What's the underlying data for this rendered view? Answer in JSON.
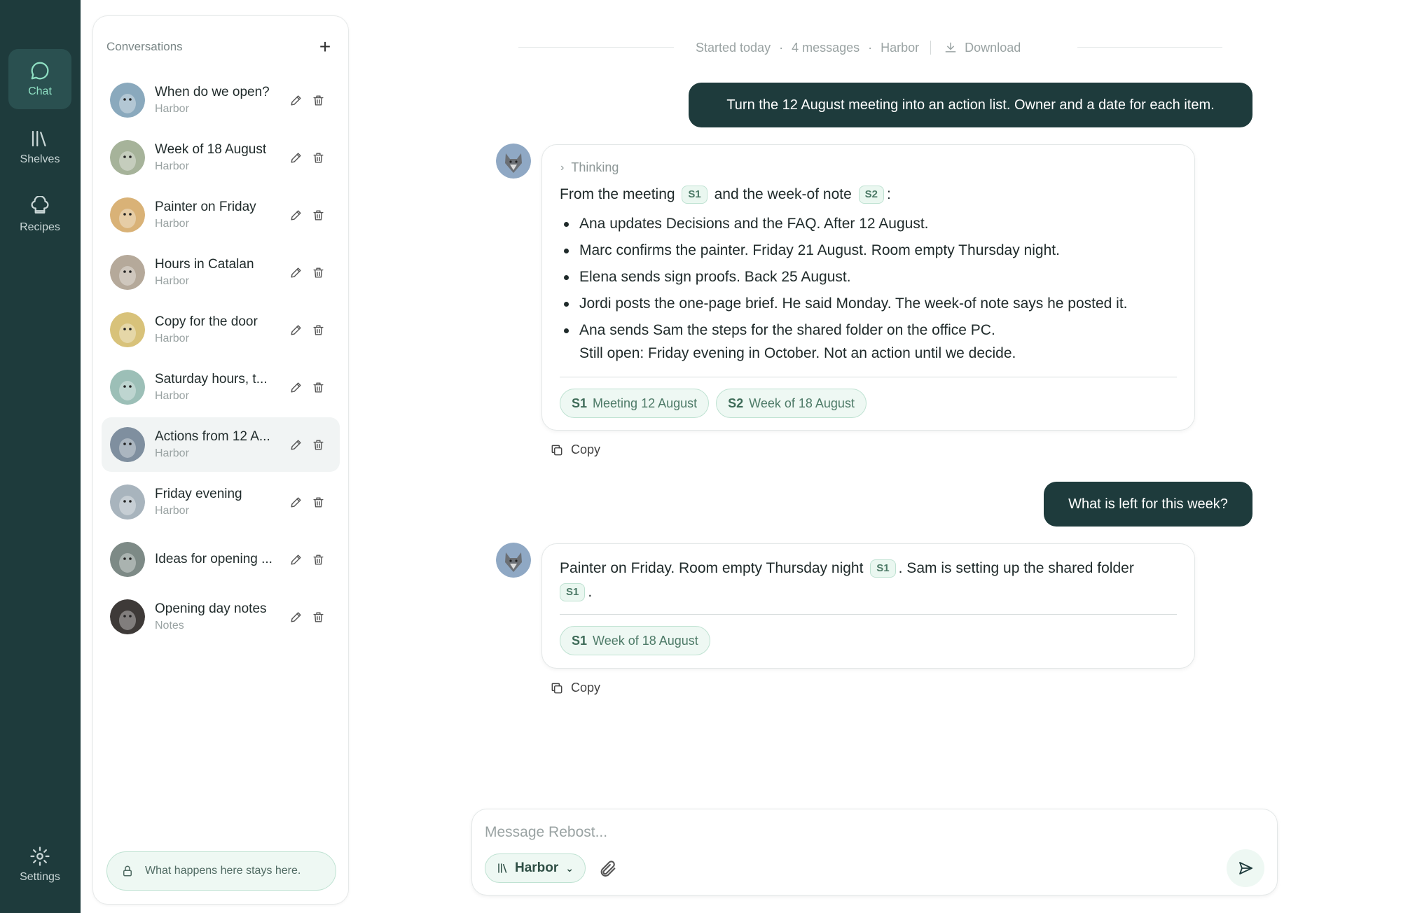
{
  "rail": {
    "chat": "Chat",
    "shelves": "Shelves",
    "recipes": "Recipes",
    "settings": "Settings"
  },
  "conversations": {
    "title": "Conversations",
    "items": [
      {
        "name": "When do we open?",
        "sub": "Harbor",
        "avatar": "seal",
        "color": "#8aa9bd"
      },
      {
        "name": "Week of 18 August",
        "sub": "Harbor",
        "avatar": "llama",
        "color": "#a6b39a"
      },
      {
        "name": "Painter on Friday",
        "sub": "Harbor",
        "avatar": "dog",
        "color": "#d9b277"
      },
      {
        "name": "Hours in Catalan",
        "sub": "Harbor",
        "avatar": "koala",
        "color": "#b5a99a"
      },
      {
        "name": "Copy for the door",
        "sub": "Harbor",
        "avatar": "giraffe",
        "color": "#d8c27a"
      },
      {
        "name": "Saturday hours, t...",
        "sub": "Harbor",
        "avatar": "antelope",
        "color": "#9cbfb7"
      },
      {
        "name": "Actions from 12 A...",
        "sub": "Harbor",
        "avatar": "wolf",
        "color": "#7f8f9f"
      },
      {
        "name": "Friday evening",
        "sub": "Harbor",
        "avatar": "cat",
        "color": "#a8b4bd"
      },
      {
        "name": "Ideas for opening ...",
        "sub": "",
        "avatar": "raccoon",
        "color": "#7d8a86"
      },
      {
        "name": "Opening day notes",
        "sub": "Notes",
        "avatar": "chimp",
        "color": "#3e3a38"
      }
    ],
    "privacy": "What happens here stays here."
  },
  "meta": {
    "started": "Started today",
    "messages": "4 messages",
    "shelf": "Harbor",
    "download": "Download"
  },
  "messages": {
    "user1": "Turn the 12 August meeting into an action list. Owner and a date for each item.",
    "thinking": "Thinking",
    "bot1_intro_a": "From the meeting",
    "bot1_intro_b": "and the week-of note",
    "bot1_intro_c": ":",
    "bot1_bullets": [
      "Ana updates Decisions and the FAQ. After 12 August.",
      "Marc confirms the painter. Friday 21 August. Room empty Thursday night.",
      "Elena sends sign proofs. Back 25 August.",
      "Jordi posts the one-page brief. He said Monday. The week-of note says he posted it.",
      "Ana sends Sam the steps for the shared folder on the office PC."
    ],
    "bot1_tail": "Still open: Friday evening in October. Not an action until we decide.",
    "bot1_sources": [
      {
        "tag": "S1",
        "label": "Meeting 12 August"
      },
      {
        "tag": "S2",
        "label": "Week of 18 August"
      }
    ],
    "copy": "Copy",
    "user2": "What is left for this week?",
    "bot2_a": "Painter on Friday. Room empty Thursday night",
    "bot2_b": ". Sam is setting up the shared folder",
    "bot2_c": ".",
    "bot2_sources": [
      {
        "tag": "S1",
        "label": "Week of 18 August"
      }
    ],
    "chip_s1": "S1",
    "chip_s2": "S2"
  },
  "composer": {
    "placeholder": "Message Rebost...",
    "scope": "Harbor"
  }
}
